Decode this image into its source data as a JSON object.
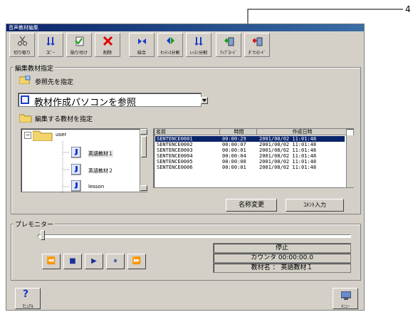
{
  "window": {
    "title": "音声教材編集"
  },
  "callout": {
    "number": "4"
  },
  "toolbar": [
    {
      "label": "切り取り",
      "icon": "scissors-icon"
    },
    {
      "label": "ｺﾋﾟｰ",
      "icon": "copy-icon"
    },
    {
      "label": "貼り付け",
      "icon": "paste-icon"
    },
    {
      "label": "削除",
      "icon": "delete-icon"
    },
    {
      "label": "結合",
      "icon": "merge-icon"
    },
    {
      "label": "ｾﾝﾃﾝｽ分割",
      "icon": "sentence-split-icon"
    },
    {
      "label": "ﾚｯｽﾝ分割",
      "icon": "lesson-split-icon"
    },
    {
      "label": "ｱｯﾌﾟﾛｰﾄﾞ",
      "icon": "upload-icon"
    },
    {
      "label": "ﾀﾞｳﾝﾛｰﾄﾞ",
      "icon": "download-icon"
    }
  ],
  "edit_section": {
    "title": "編集教材指定",
    "ref_label": "参照先を指定",
    "ref_select_value": "教材作成パソコンを参照",
    "material_label": "編集する教材を指定"
  },
  "tree": {
    "root": "user",
    "items": [
      "英語教材１",
      "英語教材２",
      "lesson"
    ]
  },
  "file_list": {
    "columns": [
      "名前",
      "時間",
      "作成日時"
    ],
    "rows": [
      {
        "name": "SENTENCE0001",
        "time": "00:00:29",
        "created": "2001/08/02 11:01:48"
      },
      {
        "name": "SENTENCE0002",
        "time": "00:00:07",
        "created": "2001/08/02 11:01:48"
      },
      {
        "name": "SENTENCE0003",
        "time": "00:00:01",
        "created": "2001/08/02 11:01:48"
      },
      {
        "name": "SENTENCE0004",
        "time": "00:00:04",
        "created": "2001/08/02 11:01:48"
      },
      {
        "name": "SENTENCE0005",
        "time": "00:00:00",
        "created": "2001/08/02 11:01:48"
      },
      {
        "name": "SENTENCE0006",
        "time": "00:00:01",
        "created": "2001/08/02 11:01:48"
      }
    ]
  },
  "buttons": {
    "rename": "名称変更",
    "comment": "ｺﾒﾝﾄ入力"
  },
  "monitor": {
    "title": "プレモニター",
    "status": "停止",
    "counter": "カウンタ 00:00:00.0",
    "material_name": "教材名 ： 英語教材１",
    "controls": [
      "rewind-icon",
      "stop-icon",
      "play-icon",
      "pause-icon",
      "fast-forward-icon"
    ]
  },
  "footer": {
    "manual": "ﾏﾆｭｱﾙ",
    "menu": "ﾒﾆｭｰ"
  }
}
